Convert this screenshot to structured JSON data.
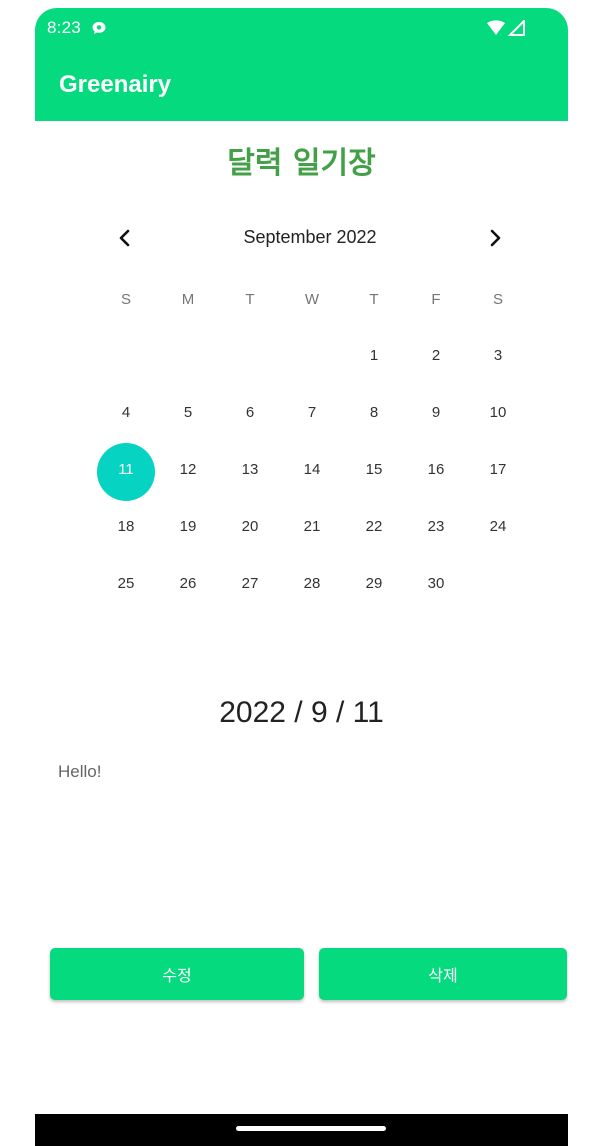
{
  "status_bar": {
    "time": "8:23",
    "notification_icon": "chat-bubble-icon",
    "right_icons": [
      "wifi-icon",
      "cellular-signal-icon"
    ]
  },
  "app_bar": {
    "title": "Greenairy",
    "color": "#05da7f"
  },
  "page": {
    "title": "달력 일기장",
    "title_color": "#43a047"
  },
  "calendar": {
    "month_label": "September 2022",
    "prev_icon": "chevron-left-icon",
    "next_icon": "chevron-right-icon",
    "weekdays": [
      "S",
      "M",
      "T",
      "W",
      "T",
      "F",
      "S"
    ],
    "leading_empty_days": 4,
    "days": [
      "1",
      "2",
      "3",
      "4",
      "5",
      "6",
      "7",
      "8",
      "9",
      "10",
      "11",
      "12",
      "13",
      "14",
      "15",
      "16",
      "17",
      "18",
      "19",
      "20",
      "21",
      "22",
      "23",
      "24",
      "25",
      "26",
      "27",
      "28",
      "29",
      "30"
    ],
    "selected_day": "11",
    "selected_color": "#06d3c2"
  },
  "entry": {
    "date": "2022 / 9 / 11",
    "text": "Hello!"
  },
  "buttons": {
    "edit_label": "수정",
    "delete_label": "삭제"
  },
  "nav_bar": {
    "home_indicator": "home-indicator"
  }
}
